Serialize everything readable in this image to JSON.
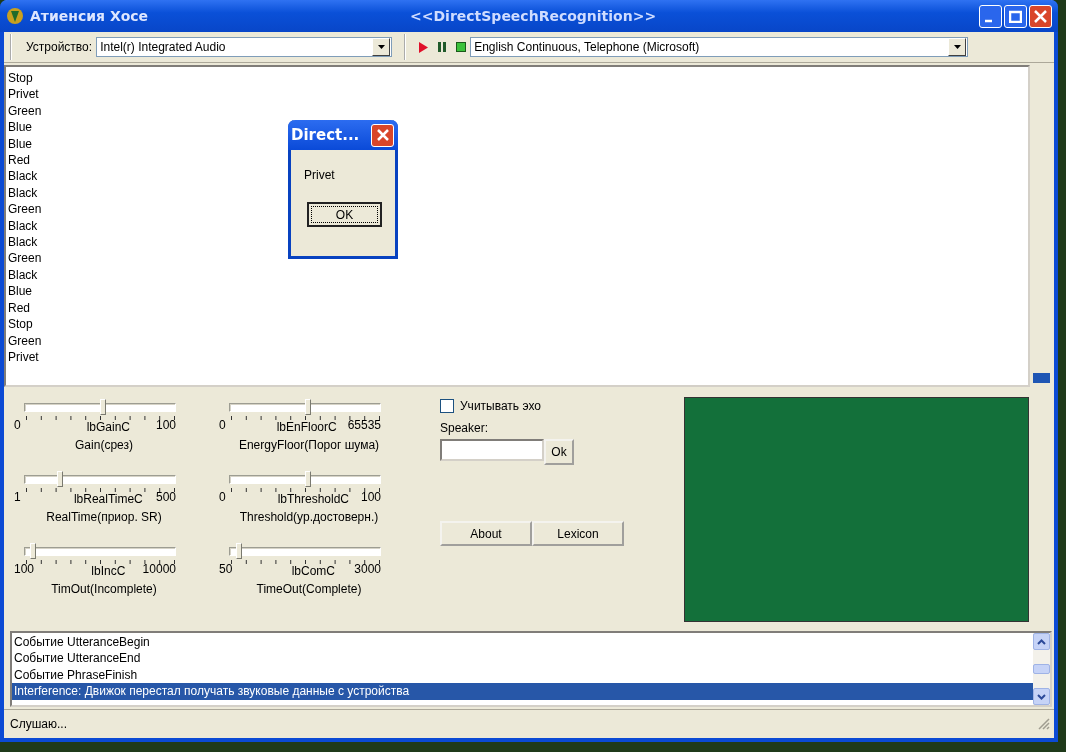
{
  "window": {
    "title": "Атиенсия Хосе",
    "caption": "<<DirectSpeechRecognition>>"
  },
  "toolbar": {
    "device_label": "Устройство:",
    "device": "Intel(r) Integrated Audio",
    "engine": "English Continuous, Telephone (Microsoft)"
  },
  "recognized_words": [
    "Stop",
    "Privet",
    "Green",
    "Blue",
    "Blue",
    "Red",
    "Black",
    "Black",
    "Green",
    "Black",
    "Black",
    "Green",
    "Black",
    "Blue",
    "Red",
    "Stop",
    "Green",
    "Privet"
  ],
  "dialog": {
    "title": "Direct...",
    "message": "Privet",
    "button": "OK"
  },
  "sliders": [
    {
      "min": "0",
      "max": "100",
      "value_label": "lbGainC",
      "caption": "Gain(срез)",
      "level": 0.52
    },
    {
      "min": "0",
      "max": "65535",
      "value_label": "lbEnFloorC",
      "caption": "EnergyFloor(Порог шума)",
      "level": 0.52
    },
    {
      "min": "1",
      "max": "500",
      "value_label": "lbRealTimeC",
      "caption": "RealTime(приор. SR)",
      "level": 0.23
    },
    {
      "min": "0",
      "max": "100",
      "value_label": "lbThresholdC",
      "caption": "Threshold(ур.достоверн.)",
      "level": 0.52
    },
    {
      "min": "100",
      "max": "10000",
      "value_label": "lbIncC",
      "caption": "TimOut(Incomplete)",
      "level": 0.05
    },
    {
      "min": "50",
      "max": "3000",
      "value_label": "lbComC",
      "caption": "TimeOut(Complete)",
      "level": 0.06
    }
  ],
  "echo_checkbox": {
    "label": "Учитывать эхо",
    "checked": false
  },
  "speaker": {
    "label": "Speaker:",
    "button": "Ok"
  },
  "buttons": [
    "About",
    "Lexicon"
  ],
  "events": [
    {
      "text": "Событие UtteranceBegin",
      "selected": false
    },
    {
      "text": "Событие UtteranceEnd",
      "selected": false
    },
    {
      "text": "Событие PhraseFinish",
      "selected": false
    },
    {
      "text": "Interference: Движок перестал получать звуковые данные с устройства",
      "selected": true
    }
  ],
  "status_bar": "Слушаю..."
}
